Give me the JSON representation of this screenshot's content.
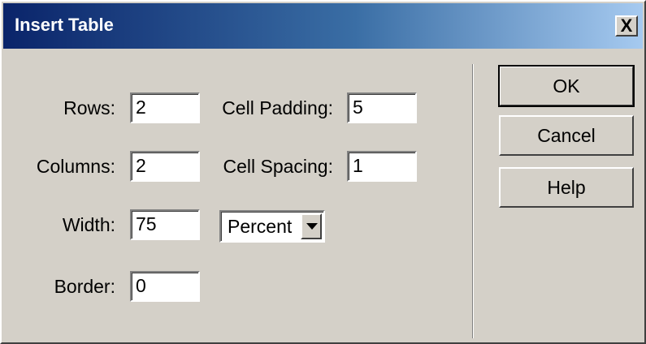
{
  "window": {
    "title": "Insert Table",
    "close_label": "X"
  },
  "form": {
    "rows": {
      "label": "Rows:",
      "value": "2"
    },
    "columns": {
      "label": "Columns:",
      "value": "2"
    },
    "width": {
      "label": "Width:",
      "value": "75"
    },
    "border": {
      "label": "Border:",
      "value": "0"
    },
    "cell_padding": {
      "label": "Cell Padding:",
      "value": "5"
    },
    "cell_spacing": {
      "label": "Cell Spacing:",
      "value": "1"
    },
    "width_unit": {
      "selected": "Percent"
    }
  },
  "buttons": {
    "ok": "OK",
    "cancel": "Cancel",
    "help": "Help"
  }
}
